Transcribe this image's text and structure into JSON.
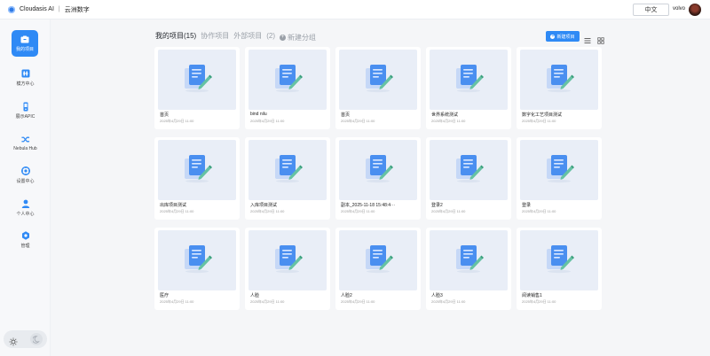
{
  "header": {
    "brand": "Cloudasis AI",
    "separator": "|",
    "org": "云洲数字",
    "lang_button": "中文",
    "user_name": "volvo"
  },
  "sidebar": {
    "items": [
      {
        "label": "我的项目",
        "icon": "folder-icon",
        "active": true
      },
      {
        "label": "模方中心",
        "icon": "model-hub-icon",
        "active": false
      },
      {
        "label": "展示APIC",
        "icon": "display-device-icon",
        "active": false
      },
      {
        "label": "Nebula Hub",
        "icon": "shuffle-icon",
        "active": false
      },
      {
        "label": "设置中心",
        "icon": "settings-icon",
        "active": false
      },
      {
        "label": "个人中心",
        "icon": "person-icon",
        "active": false
      },
      {
        "label": "管理",
        "icon": "admin-gear-icon",
        "active": false
      }
    ],
    "theme_toggle": {
      "light_icon": "sun-icon",
      "dark_icon": "moon-icon"
    }
  },
  "main": {
    "tabs": [
      {
        "label": "我的项目(15)",
        "active": true
      },
      {
        "label": "协作项目",
        "active": false
      },
      {
        "label": "外部项目",
        "active": false
      }
    ],
    "external_count": "(2)",
    "new_group_label": "新建分组",
    "new_project_label": "新建项目",
    "accent_color": "#2f8af5",
    "projects": [
      {
        "name": "首页",
        "date": "2025年4月29日 11:00"
      },
      {
        "name": "bind nilu",
        "date": "2025年4月29日 11:00"
      },
      {
        "name": "首页",
        "date": "2025年4月29日 11:00"
      },
      {
        "name": "世界系统测试",
        "date": "2025年4月29日 11:00"
      },
      {
        "name": "数字化工艺项目测试",
        "date": "2025年4月29日 11:00"
      },
      {
        "name": "出库项目测试",
        "date": "2025年4月29日 11:00"
      },
      {
        "name": "入库项目测试",
        "date": "2025年4月29日 11:00"
      },
      {
        "name": "副本_2025-11-18 15:48:4···",
        "date": "2025年4月29日 11:00"
      },
      {
        "name": "登录2",
        "date": "2025年4月29日 11:00"
      },
      {
        "name": "登录",
        "date": "2025年4月29日 11:00"
      },
      {
        "name": "医疗",
        "date": "2025年4月29日 11:00"
      },
      {
        "name": "人脸",
        "date": "2025年4月29日 11:00"
      },
      {
        "name": "人脸2",
        "date": "2025年4月29日 11:00"
      },
      {
        "name": "人脸3",
        "date": "2025年4月29日 11:00"
      },
      {
        "name": "阅读销售1",
        "date": "2025年4月29日 11:00"
      }
    ]
  }
}
